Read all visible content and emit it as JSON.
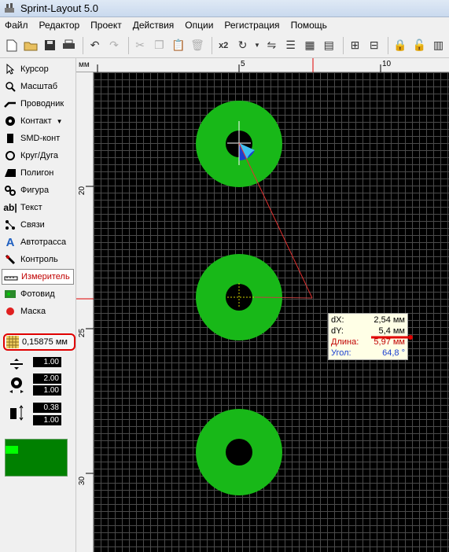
{
  "window": {
    "title": "Sprint-Layout 5.0"
  },
  "menu": [
    "Файл",
    "Редактор",
    "Проект",
    "Действия",
    "Опции",
    "Регистрация",
    "Помощь"
  ],
  "toolbar": {
    "x2_label": "x2"
  },
  "tools": [
    {
      "label": "Курсор",
      "icon": "cursor-icon"
    },
    {
      "label": "Масштаб",
      "icon": "zoom-icon"
    },
    {
      "label": "Проводник",
      "icon": "track-icon"
    },
    {
      "label": "Контакт",
      "icon": "pad-icon"
    },
    {
      "label": "SMD-конт",
      "icon": "smd-icon"
    },
    {
      "label": "Круг/Дуга",
      "icon": "circle-icon"
    },
    {
      "label": "Полигон",
      "icon": "polygon-icon"
    },
    {
      "label": "Фигура",
      "icon": "figure-icon"
    },
    {
      "label": "Текст",
      "icon": "text-icon"
    },
    {
      "label": "Связи",
      "icon": "connections-icon"
    },
    {
      "label": "Автотрасса",
      "icon": "autoroute-icon"
    },
    {
      "label": "Контроль",
      "icon": "control-icon"
    },
    {
      "label": "Измеритель",
      "icon": "measure-icon"
    },
    {
      "label": "Фотовид",
      "icon": "photoview-icon"
    },
    {
      "label": "Маска",
      "icon": "mask-icon"
    }
  ],
  "active_tool": "Измеритель",
  "grid": {
    "value": "0,15875 мм"
  },
  "params": {
    "track_width": "1.00",
    "pad_outer": "2.00",
    "pad_inner": "1.00",
    "smd_width": "0.38",
    "smd_height": "1.00"
  },
  "ruler": {
    "unit": "мм",
    "h_labels": [
      "5",
      "10"
    ],
    "v_labels": [
      "20",
      "25",
      "30"
    ]
  },
  "measure": {
    "dx_key": "dX:",
    "dx_val": "2,54 мм",
    "dy_key": "dY:",
    "dy_val": "5,4 мм",
    "len_key": "Длина:",
    "len_val": "5,97 мм",
    "angle_key": "Угол:",
    "angle_val": "64,8 °"
  },
  "colors": {
    "pad": "#18b818",
    "canvas": "#000000",
    "active_tool_text": "#c00000",
    "highlight": "#e00000"
  }
}
